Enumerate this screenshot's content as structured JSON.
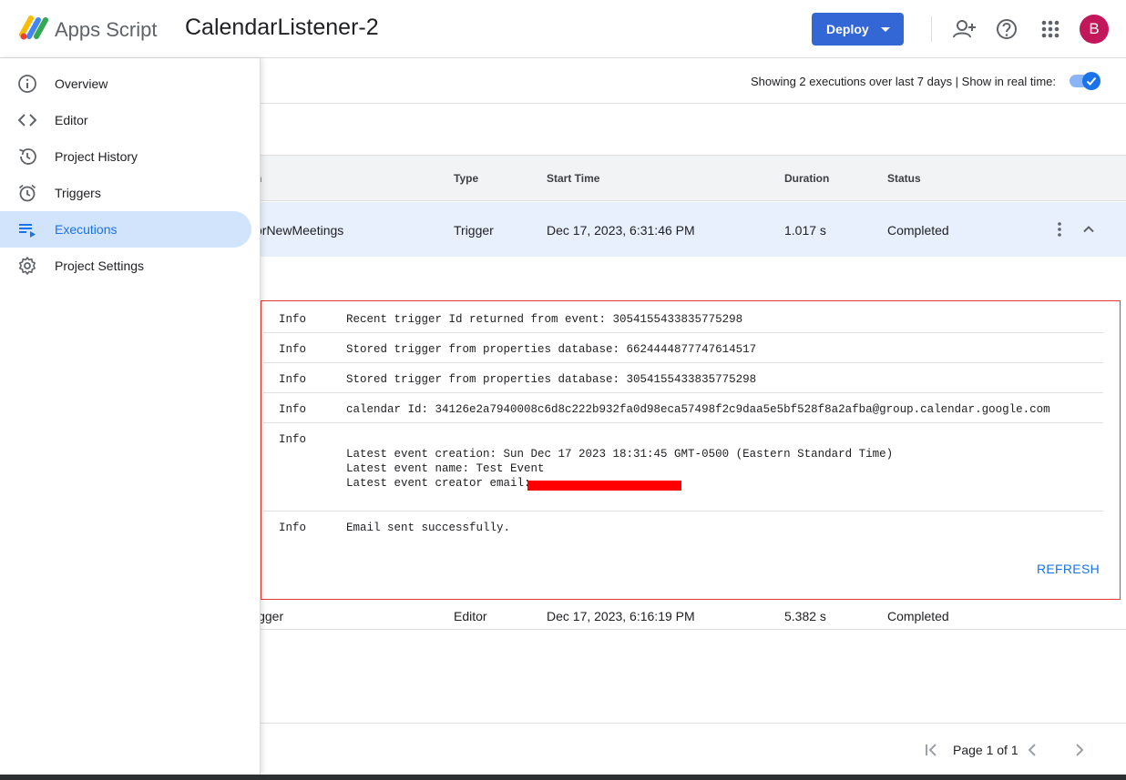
{
  "app": {
    "brand": "Apps Script",
    "project_title": "CalendarListener-2",
    "deploy_label": "Deploy",
    "avatar_initial": "B"
  },
  "sidebar": {
    "items": [
      {
        "label": "Overview",
        "icon": "info-icon"
      },
      {
        "label": "Editor",
        "icon": "code-icon"
      },
      {
        "label": "Project History",
        "icon": "history-icon"
      },
      {
        "label": "Triggers",
        "icon": "alarm-icon"
      },
      {
        "label": "Executions",
        "icon": "executions-list-icon",
        "active": true
      },
      {
        "label": "Project Settings",
        "icon": "gear-icon"
      }
    ]
  },
  "summary": {
    "text": "Showing 2 executions over last 7 days   |   Show in real time:",
    "realtime_on": true
  },
  "table": {
    "headers": [
      "n",
      "Type",
      "Start Time",
      "Duration",
      "Status"
    ],
    "rows": [
      {
        "function": "orNewMeetings",
        "type": "Trigger",
        "start": "Dec 17, 2023, 6:31:46 PM",
        "duration": "1.017 s",
        "status": "Completed"
      },
      {
        "function": "igger",
        "type": "Editor",
        "start": "Dec 17, 2023, 6:16:19 PM",
        "duration": "5.382 s",
        "status": "Completed"
      }
    ]
  },
  "logs": [
    {
      "level": "Info",
      "message": "Recent trigger Id returned from event: 3054155433835775298"
    },
    {
      "level": "Info",
      "message": "Stored trigger from properties database: 6624444877747614517"
    },
    {
      "level": "Info",
      "message": "Stored trigger from properties database: 3054155433835775298"
    },
    {
      "level": "Info",
      "message": "calendar Id: 34126e2a7940008c6d8c222b932fa0d98eca57498f2c9daa5e5bf528f8a2afba@group.calendar.google.com"
    },
    {
      "level": "Info",
      "message": "",
      "lines": [
        "Latest event creation: Sun Dec 17 2023 18:31:45 GMT-0500 (Eastern Standard Time)",
        "Latest event name: Test Event",
        "Latest event creator email: "
      ]
    },
    {
      "level": "Info",
      "message": "Email sent successfully."
    }
  ],
  "refresh_label": "REFRESH",
  "pager": {
    "text": "Page 1 of 1"
  }
}
